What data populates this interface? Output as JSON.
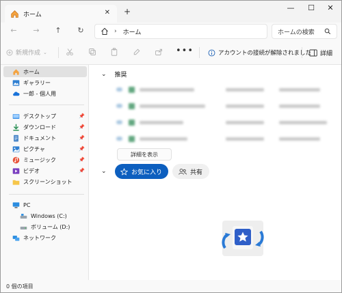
{
  "tab": {
    "title": "ホーム",
    "close": "✕",
    "new": "+"
  },
  "window_controls": {
    "minimize": "—",
    "maximize": "☐",
    "close": "✕"
  },
  "nav": {
    "back": "←",
    "forward": "→",
    "up": "↑",
    "refresh": "↻"
  },
  "address": {
    "crumb": "ホーム",
    "separator": "›"
  },
  "search": {
    "placeholder": "ホームの検索"
  },
  "commands": {
    "new_label": "新規作成",
    "more": "•••",
    "info_text": "アカウントの接続が解除されました",
    "details_label": "詳細"
  },
  "sidebar": {
    "top": [
      {
        "label": "ホーム",
        "icon": "home-icon"
      },
      {
        "label": "ギャラリー",
        "icon": "gallery-icon"
      },
      {
        "label": "一郎 - 個人用",
        "icon": "onedrive-cloud-icon"
      }
    ],
    "pinned": [
      {
        "label": "デスクトップ",
        "icon": "desktop-icon",
        "pin": "📌"
      },
      {
        "label": "ダウンロード",
        "icon": "download-icon",
        "pin": "📌"
      },
      {
        "label": "ドキュメント",
        "icon": "documents-icon",
        "pin": "📌"
      },
      {
        "label": "ピクチャ",
        "icon": "pictures-icon",
        "pin": "📌"
      },
      {
        "label": "ミュージック",
        "icon": "music-icon",
        "pin": "📌"
      },
      {
        "label": "ビデオ",
        "icon": "videos-icon",
        "pin": "📌"
      },
      {
        "label": "スクリーンショット",
        "icon": "folder-icon"
      }
    ],
    "devices": [
      {
        "label": "PC",
        "icon": "pc-icon"
      },
      {
        "label": "Windows (C:)",
        "icon": "drive-icon"
      },
      {
        "label": "ボリューム (D:)",
        "icon": "drive-icon"
      },
      {
        "label": "ネットワーク",
        "icon": "network-icon"
      }
    ]
  },
  "main": {
    "recommended_header": "推奨",
    "show_details": "詳細を表示",
    "favorites_pill": "お気に入り",
    "shared_pill": "共有"
  },
  "status": {
    "text": "0 個の項目"
  },
  "colors": {
    "accent": "#0d5fbf",
    "selected": "#e1e1e1"
  }
}
